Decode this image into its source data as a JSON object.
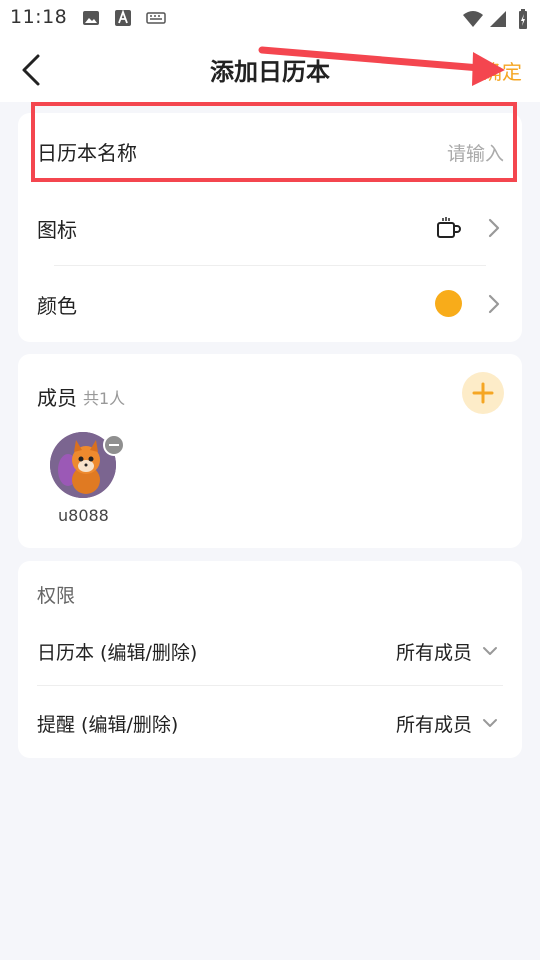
{
  "status_bar": {
    "time": "11:18"
  },
  "header": {
    "title": "添加日历本",
    "confirm_label": "确定"
  },
  "name_row": {
    "label": "日历本名称",
    "placeholder": "请输入"
  },
  "icon_row": {
    "label": "图标",
    "icon": "cup-icon"
  },
  "color_row": {
    "label": "颜色",
    "color": "#f8ac1a"
  },
  "members": {
    "title": "成员",
    "count": "共1人",
    "list": [
      {
        "name": "u8088"
      }
    ]
  },
  "permissions": {
    "title": "权限",
    "rows": [
      {
        "label": "日历本 (编辑/删除)",
        "value": "所有成员"
      },
      {
        "label": "提醒 (编辑/删除)",
        "value": "所有成员"
      }
    ]
  },
  "colors": {
    "accent": "#f5a623",
    "annotation": "#f4464f"
  }
}
